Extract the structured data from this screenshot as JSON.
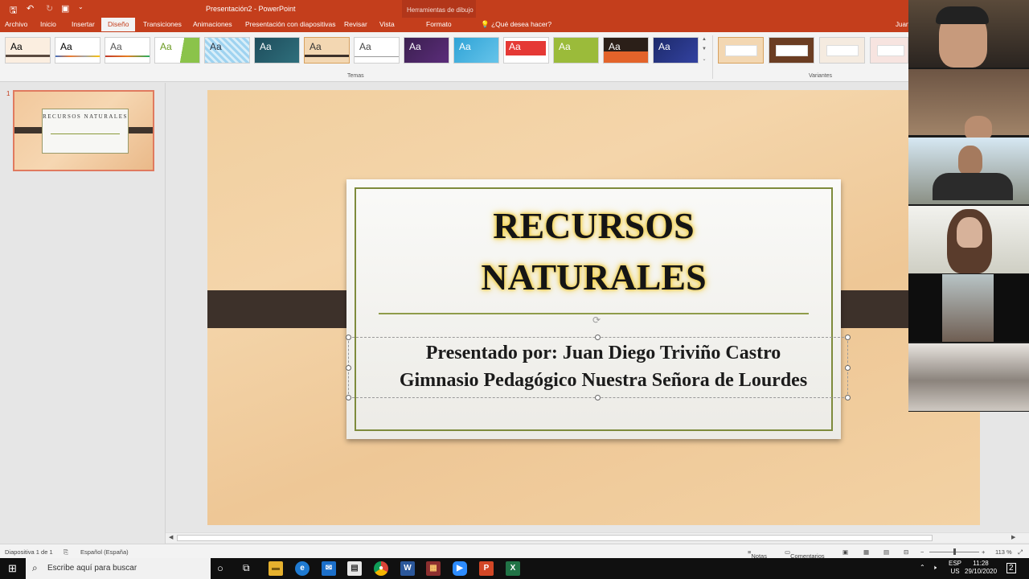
{
  "app": {
    "window_title": "Presentación2 - PowerPoint",
    "context_tools": "Herramientas de dibujo",
    "user": "Juan"
  },
  "tabs": [
    {
      "label": "Archivo"
    },
    {
      "label": "Inicio"
    },
    {
      "label": "Insertar"
    },
    {
      "label": "Diseño",
      "active": true
    },
    {
      "label": "Transiciones"
    },
    {
      "label": "Animaciones"
    },
    {
      "label": "Presentación con diapositivas"
    },
    {
      "label": "Revisar"
    },
    {
      "label": "Vista"
    },
    {
      "label": "Formato"
    }
  ],
  "help": "¿Qué desea hacer?",
  "ribbon": {
    "themes_label": "Temas",
    "variants_label": "Variantes",
    "theme_glyph": "Aa"
  },
  "thumbnail": {
    "number": "1",
    "title": "RECURSOS NATURALES"
  },
  "slide": {
    "title_line1": "RECURSOS",
    "title_line2": "NATURALES",
    "subtitle_line1": "Presentado por: Juan Diego Triviño Castro",
    "subtitle_line2": "Gimnasio Pedagógico Nuestra Señora de Lourdes"
  },
  "status": {
    "slide_counter": "Diapositiva 1 de 1",
    "language": "Español (España)",
    "notes": "Notas",
    "comments": "Comentarios",
    "zoom": "113 %"
  },
  "taskbar": {
    "search_placeholder": "Escribe aquí para buscar",
    "lang_top": "ESP",
    "lang_bottom": "US",
    "time": "11:28",
    "date": "29/10/2020",
    "notifications": "2"
  },
  "colors": {
    "accent": "#c43e1c",
    "slide_band": "#3d312a",
    "frame": "#7e8b3c"
  }
}
